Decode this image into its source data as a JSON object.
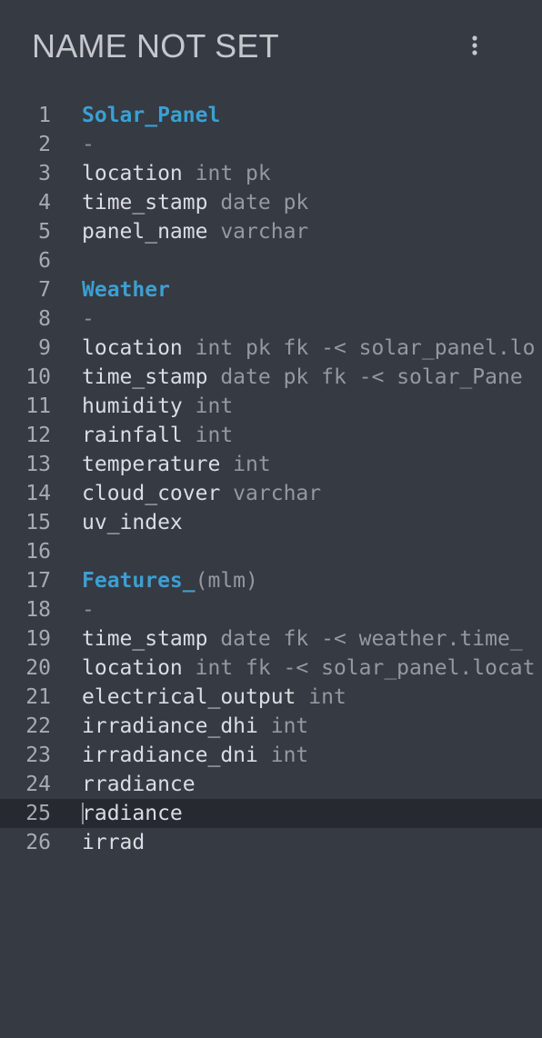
{
  "header": {
    "title": "NAME NOT SET",
    "menu_icon": "vertical-ellipsis-icon"
  },
  "colors": {
    "background": "#353a43",
    "active_line": "#262a30",
    "table_name": "#3c9fd1",
    "identifier": "#dadde2",
    "type_text": "#9499a1"
  },
  "editor": {
    "active_line": 25,
    "lines": [
      {
        "num": "1",
        "segments": [
          {
            "t": "Solar_Panel",
            "k": "table"
          }
        ]
      },
      {
        "num": "2",
        "segments": [
          {
            "t": "-",
            "k": "dash"
          }
        ]
      },
      {
        "num": "3",
        "segments": [
          {
            "t": "location",
            "k": "ident"
          },
          {
            "t": " int pk",
            "k": "type"
          }
        ]
      },
      {
        "num": "4",
        "segments": [
          {
            "t": "time_stamp",
            "k": "ident"
          },
          {
            "t": " date pk",
            "k": "type"
          }
        ]
      },
      {
        "num": "5",
        "segments": [
          {
            "t": "panel_name",
            "k": "ident"
          },
          {
            "t": " varchar",
            "k": "type"
          }
        ]
      },
      {
        "num": "6",
        "segments": []
      },
      {
        "num": "7",
        "segments": [
          {
            "t": "Weather",
            "k": "table"
          }
        ]
      },
      {
        "num": "8",
        "segments": [
          {
            "t": "-",
            "k": "dash"
          }
        ]
      },
      {
        "num": "9",
        "segments": [
          {
            "t": "location",
            "k": "ident"
          },
          {
            "t": " int pk fk -< solar_panel.lo",
            "k": "type"
          }
        ]
      },
      {
        "num": "10",
        "segments": [
          {
            "t": "time_stamp",
            "k": "ident"
          },
          {
            "t": " date pk fk -< solar_Pane",
            "k": "type"
          }
        ]
      },
      {
        "num": "11",
        "segments": [
          {
            "t": "humidity",
            "k": "ident"
          },
          {
            "t": " int",
            "k": "type"
          }
        ]
      },
      {
        "num": "12",
        "segments": [
          {
            "t": "rainfall",
            "k": "ident"
          },
          {
            "t": " int",
            "k": "type"
          }
        ]
      },
      {
        "num": "13",
        "segments": [
          {
            "t": "temperature",
            "k": "ident"
          },
          {
            "t": " int",
            "k": "type"
          }
        ]
      },
      {
        "num": "14",
        "segments": [
          {
            "t": "cloud_cover",
            "k": "ident"
          },
          {
            "t": " varchar",
            "k": "type"
          }
        ]
      },
      {
        "num": "15",
        "segments": [
          {
            "t": "uv_index",
            "k": "ident"
          }
        ]
      },
      {
        "num": "16",
        "segments": []
      },
      {
        "num": "17",
        "segments": [
          {
            "t": "Features_",
            "k": "table"
          },
          {
            "t": "(mlm)",
            "k": "paren"
          }
        ]
      },
      {
        "num": "18",
        "segments": [
          {
            "t": "-",
            "k": "dash"
          }
        ]
      },
      {
        "num": "19",
        "segments": [
          {
            "t": "time_stamp",
            "k": "ident"
          },
          {
            "t": " date fk -< weather.time_",
            "k": "type"
          }
        ]
      },
      {
        "num": "20",
        "segments": [
          {
            "t": "location",
            "k": "ident"
          },
          {
            "t": " int fk -< solar_panel.locat",
            "k": "type"
          }
        ]
      },
      {
        "num": "21",
        "segments": [
          {
            "t": "electrical_output",
            "k": "ident"
          },
          {
            "t": " int",
            "k": "type"
          }
        ]
      },
      {
        "num": "22",
        "segments": [
          {
            "t": "irradiance_dhi",
            "k": "ident"
          },
          {
            "t": " int",
            "k": "type"
          }
        ]
      },
      {
        "num": "23",
        "segments": [
          {
            "t": "irradiance_dni",
            "k": "ident"
          },
          {
            "t": " int",
            "k": "type"
          }
        ]
      },
      {
        "num": "24",
        "segments": [
          {
            "t": "rradiance",
            "k": "ident"
          }
        ]
      },
      {
        "num": "25",
        "segments": [
          {
            "t": "radiance",
            "k": "ident"
          }
        ]
      },
      {
        "num": "26",
        "segments": [
          {
            "t": "irrad",
            "k": "ident"
          }
        ]
      }
    ]
  }
}
